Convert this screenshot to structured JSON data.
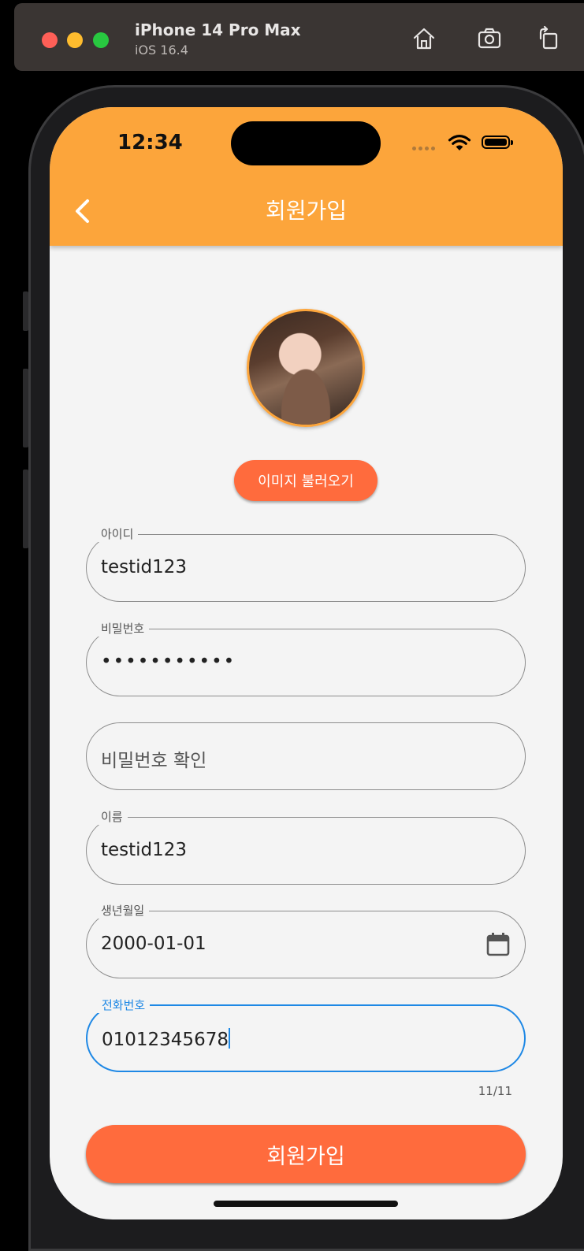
{
  "simulator": {
    "device_name": "iPhone 14 Pro Max",
    "os_version": "iOS 16.4",
    "icons": [
      "home-icon",
      "screenshot-icon",
      "rotate-icon"
    ]
  },
  "status_bar": {
    "time": "12:34"
  },
  "app_bar": {
    "title": "회원가입",
    "back_icon": "chevron-left-icon"
  },
  "profile": {
    "load_image_label": "이미지 불러오기"
  },
  "form": {
    "id": {
      "label": "아이디",
      "value": "testid123"
    },
    "password": {
      "label": "비밀번호",
      "value": "•••••••••••"
    },
    "password_confirm": {
      "placeholder": "비밀번호 확인"
    },
    "name": {
      "label": "이름",
      "value": "testid123"
    },
    "birthdate": {
      "label": "생년월일",
      "value": "2000-01-01",
      "icon": "calendar-icon"
    },
    "phone": {
      "label": "전화번호",
      "value": "01012345678",
      "counter": "11/11"
    }
  },
  "submit_label": "회원가입",
  "colors": {
    "app_bar": "#fca53b",
    "button": "#ff6b3d",
    "focus": "#1e88e5",
    "background": "#f4f4f4"
  }
}
